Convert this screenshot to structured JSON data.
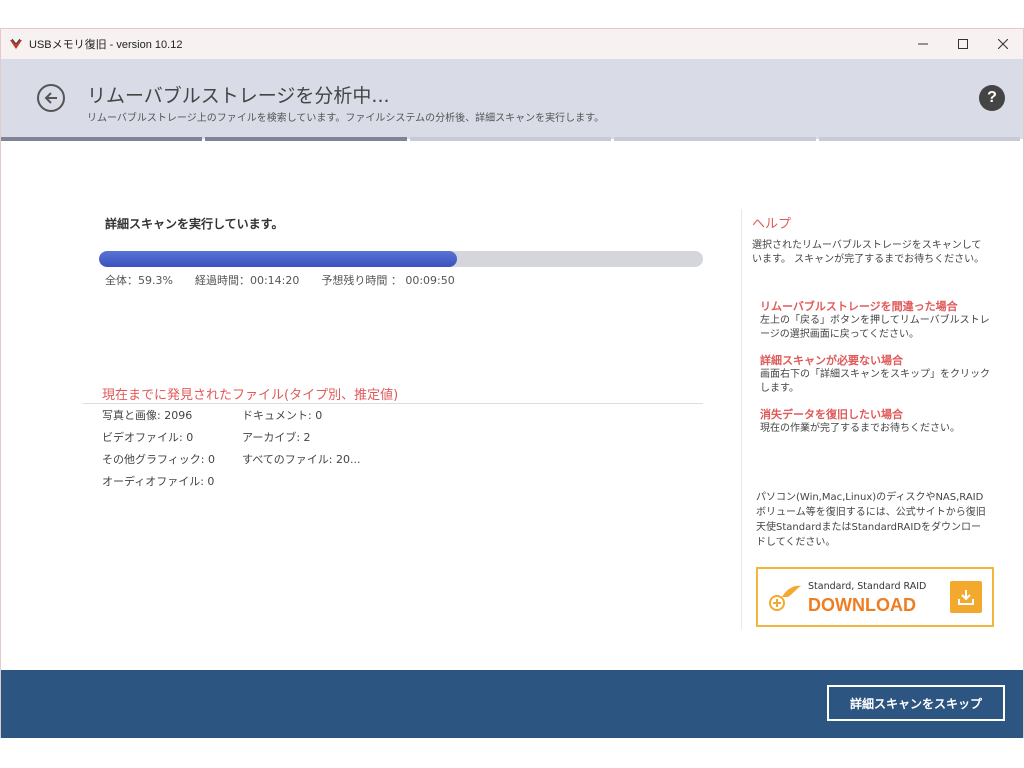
{
  "window": {
    "title": "USBメモリ復旧 - version 10.12"
  },
  "header": {
    "title": "リムーバブルストレージを分析中...",
    "subtitle": "リムーバブルストレージ上のファイルを検索しています。ファイルシステムの分析後、詳細スキャンを実行します。",
    "help_label": "?"
  },
  "scan": {
    "label": "詳細スキャンを実行しています。",
    "progress_fraction": 0.593,
    "overall": "全体：59.3%",
    "elapsed": "経過時間：00:14:20",
    "remaining": "予想残り時間 ： 00:09:50"
  },
  "found": {
    "title": "現在までに発見されたファイル(タイプ別、推定値)",
    "items": [
      "写真と画像: 2096",
      "ドキュメント: 0",
      "ビデオファイル: 0",
      "アーカイブ: 2",
      "その他グラフィック: 0",
      "すべてのファイル: 20...",
      "オーディオファイル: 0",
      ""
    ]
  },
  "help": {
    "heading": "ヘルプ",
    "intro": "選択されたリムーバブルストレージをスキャンしています。 スキャンが完了するまでお待ちください。",
    "cases": [
      {
        "title": "リムーバブルストレージを間違った場合",
        "body": "左上の「戻る」ボタンを押してリムーバブルストレージの選択画面に戻ってください。"
      },
      {
        "title": "詳細スキャンが必要ない場合",
        "body": "画面右下の「詳細スキャンをスキップ」をクリックします。"
      },
      {
        "title": "消失データを復旧したい場合",
        "body": "現在の作業が完了するまでお待ちください。"
      }
    ],
    "promo": "パソコン(Win,Mac,Linux)のディスクやNAS,RAIDボリューム等を復旧するには、公式サイトから復旧天使StandardまたはStandardRAIDをダウンロードしてください。",
    "download_small": "Standard, Standard RAID",
    "download_big": "DOWNLOAD"
  },
  "footer": {
    "skip_label": "詳細スキャンをスキップ"
  },
  "colors": {
    "accent_red": "#e05a5a",
    "footer_blue": "#2c5681",
    "progress_blue": "#4a62c9",
    "download_orange": "#ef7d22"
  }
}
